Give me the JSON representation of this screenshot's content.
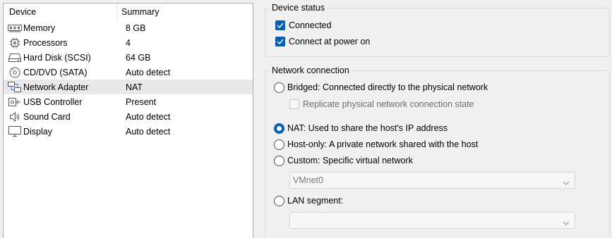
{
  "device_list": {
    "columns": {
      "device": "Device",
      "summary": "Summary"
    },
    "rows": [
      {
        "label": "Memory",
        "summary": "8 GB",
        "icon": "memory-icon"
      },
      {
        "label": "Processors",
        "summary": "4",
        "icon": "processor-icon"
      },
      {
        "label": "Hard Disk (SCSI)",
        "summary": "64 GB",
        "icon": "hard-disk-icon"
      },
      {
        "label": "CD/DVD (SATA)",
        "summary": "Auto detect",
        "icon": "cd-dvd-icon"
      },
      {
        "label": "Network Adapter",
        "summary": "NAT",
        "icon": "network-adapter-icon",
        "selected": true
      },
      {
        "label": "USB Controller",
        "summary": "Present",
        "icon": "usb-icon"
      },
      {
        "label": "Sound Card",
        "summary": "Auto detect",
        "icon": "speaker-icon"
      },
      {
        "label": "Display",
        "summary": "Auto detect",
        "icon": "monitor-icon"
      }
    ]
  },
  "device_status": {
    "title": "Device status",
    "connected": {
      "label": "Connected",
      "checked": true
    },
    "connect_at_power_on": {
      "label": "Connect at power on",
      "checked": true
    }
  },
  "network_connection": {
    "title": "Network connection",
    "bridged": {
      "label": "Bridged: Connected directly to the physical network",
      "selected": false
    },
    "replicate": {
      "label": "Replicate physical network connection state",
      "checked": false,
      "enabled": false
    },
    "nat": {
      "label": "NAT: Used to share the host's IP address",
      "selected": true
    },
    "host_only": {
      "label": "Host-only: A private network shared with the host",
      "selected": false
    },
    "custom": {
      "label": "Custom: Specific virtual network",
      "selected": false
    },
    "custom_network_value": "VMnet0",
    "lan_segment": {
      "label": "LAN segment:",
      "selected": false
    },
    "lan_segment_value": ""
  },
  "colors": {
    "accent": "#005fb8",
    "selected_row": "#e8e8e8",
    "disabled_text": "#6d6d6d"
  }
}
